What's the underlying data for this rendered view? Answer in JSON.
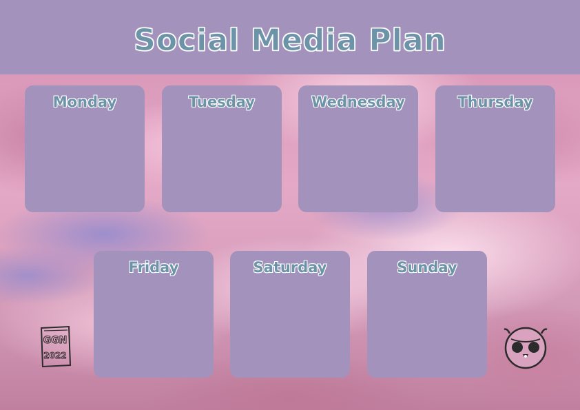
{
  "title": "Social Media Plan",
  "days": [
    {
      "label": "Monday"
    },
    {
      "label": "Tuesday"
    },
    {
      "label": "Wednesday"
    },
    {
      "label": "Thursday"
    },
    {
      "label": "Friday"
    },
    {
      "label": "Saturday"
    },
    {
      "label": "Sunday"
    }
  ],
  "stamp": {
    "line1": "GGN",
    "line2": "2022"
  },
  "colors": {
    "header": "#a392bb",
    "card": "#a392bb",
    "title_text": "#6d93a8",
    "outline": "#ffffff",
    "background": "#d9a6c0"
  },
  "icons": {
    "owl": "owl-face-icon",
    "stamp": "ggn-signature-stamp"
  }
}
